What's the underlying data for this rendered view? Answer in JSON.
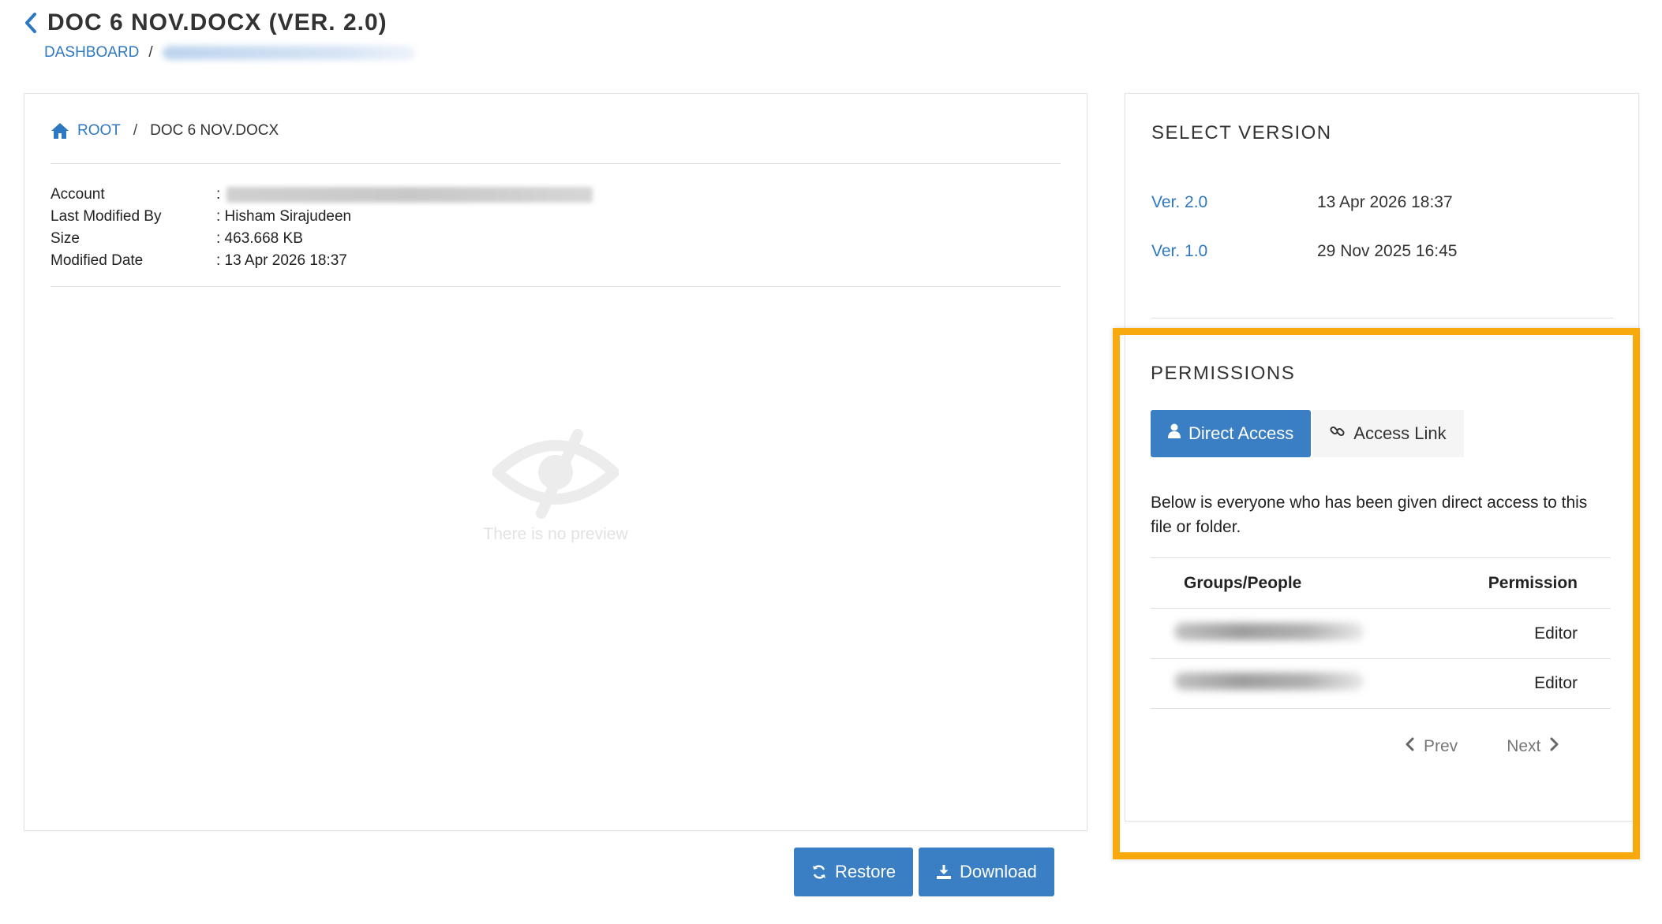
{
  "header": {
    "title": "DOC 6 NOV.DOCX (VER. 2.0)",
    "breadcrumb_dashboard": "DASHBOARD",
    "breadcrumb_sep": "/"
  },
  "file": {
    "breadcrumb_root": "ROOT",
    "breadcrumb_sep": "/",
    "breadcrumb_current": "DOC 6 NOV.DOCX",
    "meta": [
      {
        "label": "Account",
        "value": ":"
      },
      {
        "label": "Last Modified By",
        "value": ": Hisham Sirajudeen"
      },
      {
        "label": "Size",
        "value": ": 463.668 KB"
      },
      {
        "label": "Modified Date",
        "value": ": 13 Apr 2026 18:37"
      }
    ],
    "no_preview_text": "There is no preview"
  },
  "versions": {
    "title": "SELECT VERSION",
    "items": [
      {
        "label": "Ver. 2.0",
        "date": "13 Apr 2026 18:37"
      },
      {
        "label": "Ver. 1.0",
        "date": "29 Nov 2025 16:45"
      }
    ]
  },
  "permissions": {
    "title": "PERMISSIONS",
    "tab_direct": "Direct Access",
    "tab_link": "Access Link",
    "description": "Below is everyone who has been given direct access to this file or folder.",
    "col_people": "Groups/People",
    "col_permission": "Permission",
    "rows": [
      {
        "permission": "Editor"
      },
      {
        "permission": "Editor"
      }
    ],
    "prev": "Prev",
    "next": "Next"
  },
  "actions": {
    "restore": "Restore",
    "download": "Download"
  },
  "colors": {
    "accent": "#3a7fc4",
    "link": "#2e78c1",
    "highlight": "#f7a90e"
  }
}
